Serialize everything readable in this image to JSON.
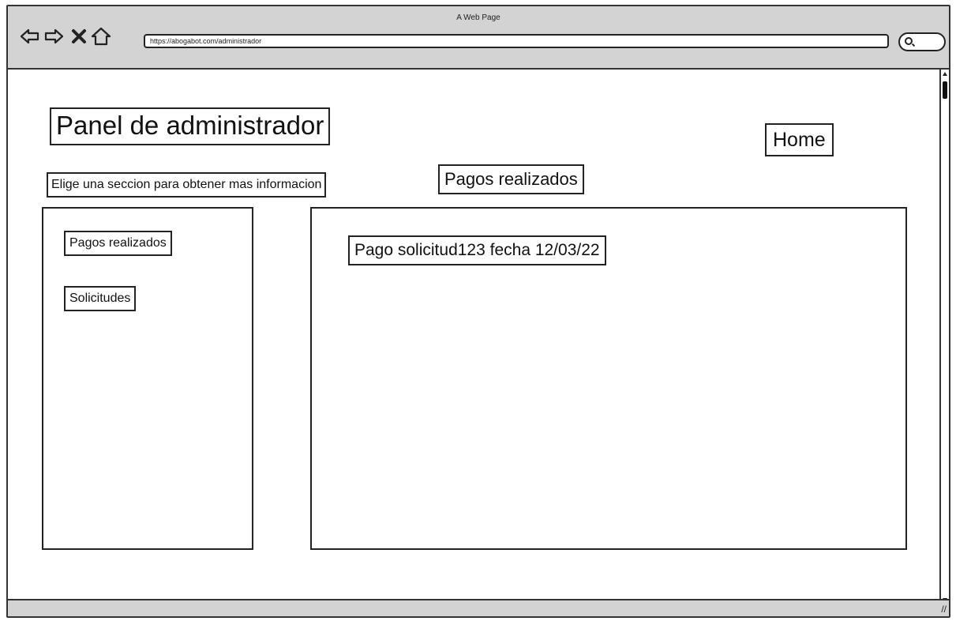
{
  "browser": {
    "window_title": "A Web Page",
    "url": "https://abogabot.com/administrador",
    "icons": [
      "back-arrow-icon",
      "forward-arrow-icon",
      "close-x-icon",
      "home-icon",
      "search-icon"
    ]
  },
  "page": {
    "title": "Panel de administrador",
    "home_label": "Home",
    "subtitle": "Elige una seccion para obtener mas informacion",
    "section_title": "Pagos realizados"
  },
  "sidebar": {
    "items": [
      {
        "label": "Pagos realizados"
      },
      {
        "label": "Solicitudes"
      }
    ]
  },
  "main": {
    "payments": [
      {
        "text": "Pago solicitud123 fecha 12/03/22"
      }
    ]
  },
  "colors": {
    "chrome": "#d3d3d3",
    "stroke": "#222222",
    "background": "#ffffff"
  }
}
